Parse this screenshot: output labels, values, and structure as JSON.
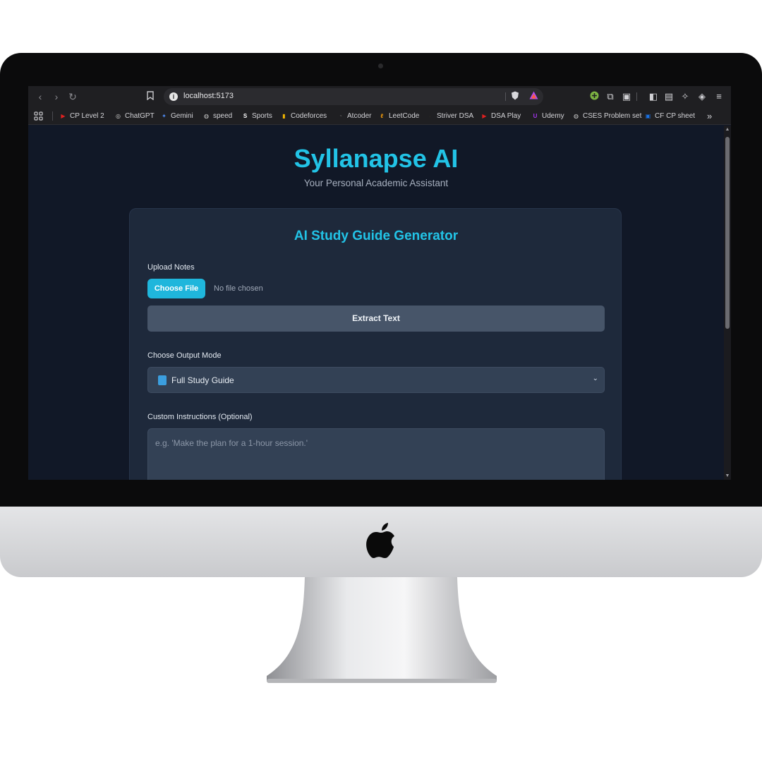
{
  "browser": {
    "url": "localhost:5173",
    "bookmarks": [
      {
        "label": "CP Level 2",
        "icon": "youtube-icon",
        "color": "#e02020"
      },
      {
        "label": "ChatGPT",
        "icon": "chatgpt-icon",
        "color": "#cfcfcf"
      },
      {
        "label": "Gemini",
        "icon": "gemini-icon",
        "color": "#4f8df5"
      },
      {
        "label": "speed",
        "icon": "globe-icon",
        "color": "#cfcfcf"
      },
      {
        "label": "Sports",
        "icon": "sports-icon",
        "color": "#ffffff"
      },
      {
        "label": "Codeforces",
        "icon": "codeforces-icon",
        "color": "#f0b400"
      },
      {
        "label": "Atcoder",
        "icon": "atcoder-icon",
        "color": "#555555"
      },
      {
        "label": "LeetCode",
        "icon": "leetcode-icon",
        "color": "#f59e0b"
      },
      {
        "label": "Striver DSA",
        "icon": "striver-icon",
        "color": "#222222"
      },
      {
        "label": "DSA Play",
        "icon": "youtube-icon",
        "color": "#e02020"
      },
      {
        "label": "Udemy",
        "icon": "udemy-icon",
        "color": "#a435f0"
      },
      {
        "label": "CSES Problem set",
        "icon": "globe-icon",
        "color": "#cfcfcf"
      },
      {
        "label": "CF CP sheet",
        "icon": "cp-sheet-icon",
        "color": "#1a73e8"
      }
    ],
    "more_label": "»"
  },
  "app": {
    "title": "Syllanapse AI",
    "subtitle": "Your Personal Academic Assistant"
  },
  "card": {
    "title": "AI Study Guide Generator",
    "upload_label": "Upload Notes",
    "choose_file_label": "Choose File",
    "file_status": "No file chosen",
    "extract_label": "Extract Text",
    "mode_label": "Choose Output Mode",
    "mode_value": "Full Study Guide",
    "instructions_label": "Custom Instructions (Optional)",
    "instructions_placeholder": "e.g. 'Make the plan for a 1-hour session.'"
  },
  "colors": {
    "accent": "#22c3e6",
    "page_bg": "#111827",
    "card_bg": "#1e293b"
  }
}
